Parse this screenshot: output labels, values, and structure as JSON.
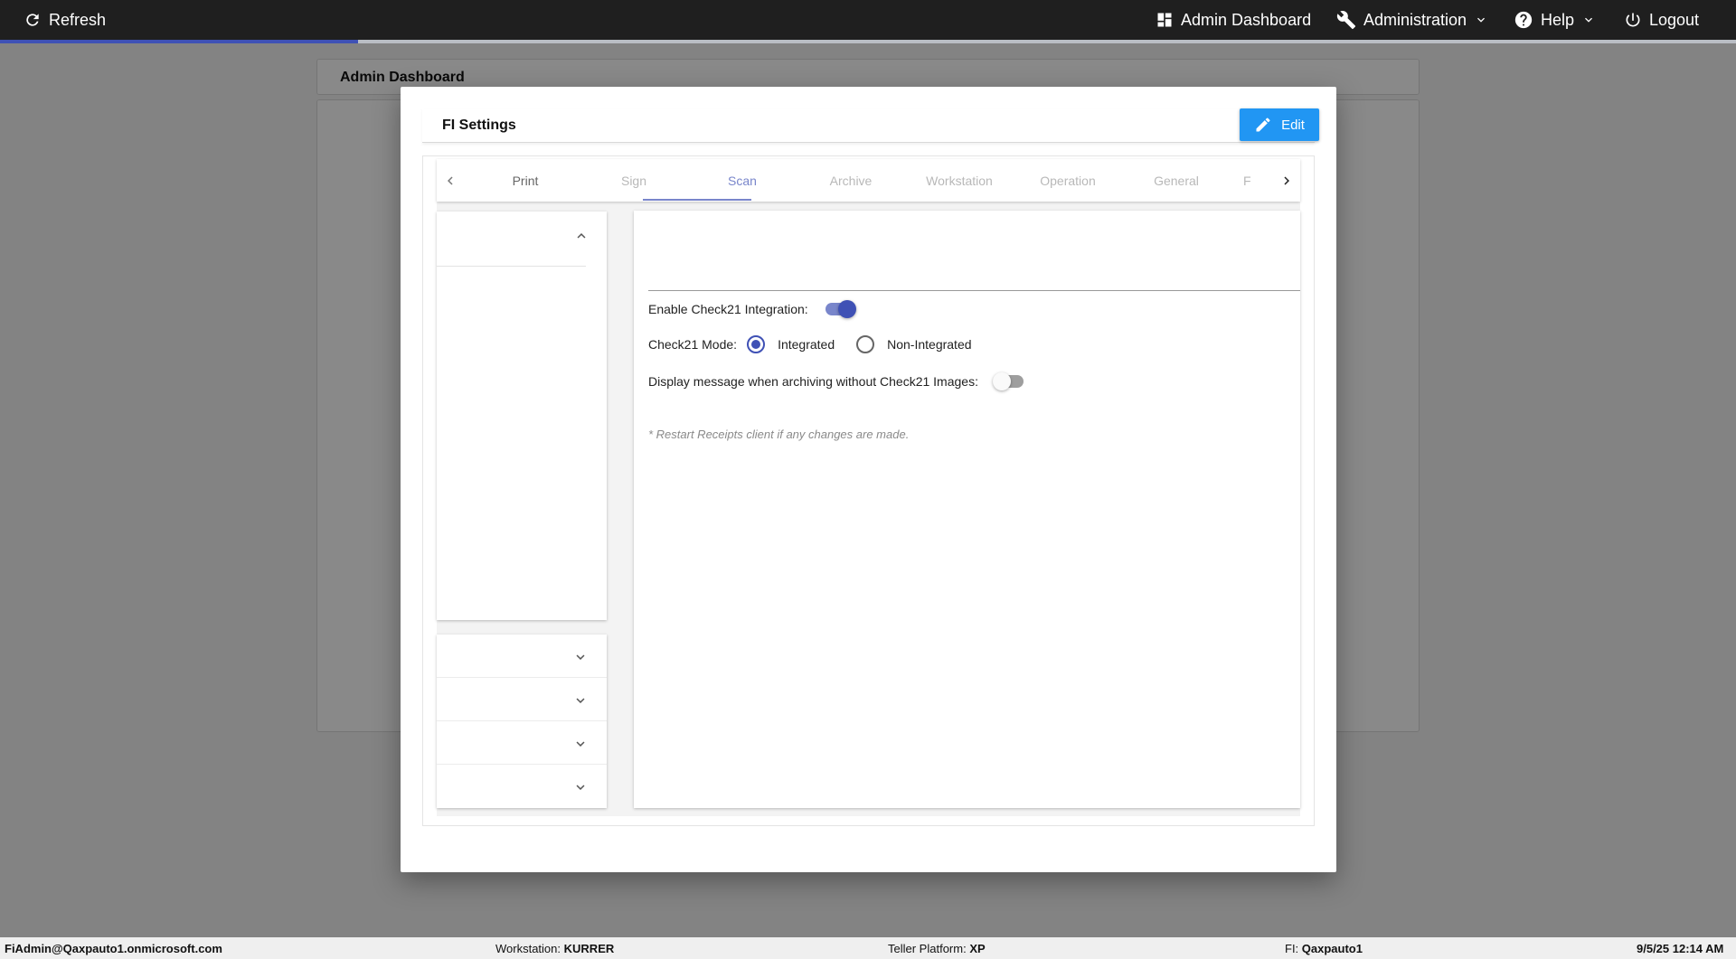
{
  "topbar": {
    "refresh_label": "Refresh",
    "admin_dashboard_label": "Admin Dashboard",
    "administration_label": "Administration",
    "help_label": "Help",
    "logout_label": "Logout",
    "progress_fraction": 0.206,
    "accent_color": "#3f51b5"
  },
  "background_page": {
    "header_title": "Admin Dashboard"
  },
  "modal": {
    "title": "FI Settings",
    "edit_label": "Edit",
    "edit_color": "#2196f3",
    "tabs": [
      {
        "label": "Print",
        "state": "normal"
      },
      {
        "label": "Sign",
        "state": "disabled"
      },
      {
        "label": "Scan",
        "state": "active"
      },
      {
        "label": "Archive",
        "state": "disabled"
      },
      {
        "label": "Workstation",
        "state": "disabled"
      },
      {
        "label": "Operation",
        "state": "disabled"
      },
      {
        "label": "General",
        "state": "disabled"
      },
      {
        "label": "F",
        "state": "disabled"
      }
    ],
    "scan": {
      "enable_check21_label": "Enable Check21 Integration:",
      "enable_check21_on": true,
      "mode_label": "Check21 Mode:",
      "mode_options": [
        "Integrated",
        "Non-Integrated"
      ],
      "mode_selected": "Integrated",
      "display_message_label": "Display message when archiving without Check21 Images:",
      "display_message_on": false,
      "restart_note": "* Restart Receipts client if any changes are made."
    }
  },
  "statusbar": {
    "user": "FiAdmin@Qaxpauto1.onmicrosoft.com",
    "workstation_label": "Workstation:",
    "workstation_value": "KURRER",
    "platform_label": "Teller Platform:",
    "platform_value": "XP",
    "fi_label": "FI:",
    "fi_value": "Qaxpauto1",
    "datetime": "9/5/25 12:14 AM"
  }
}
